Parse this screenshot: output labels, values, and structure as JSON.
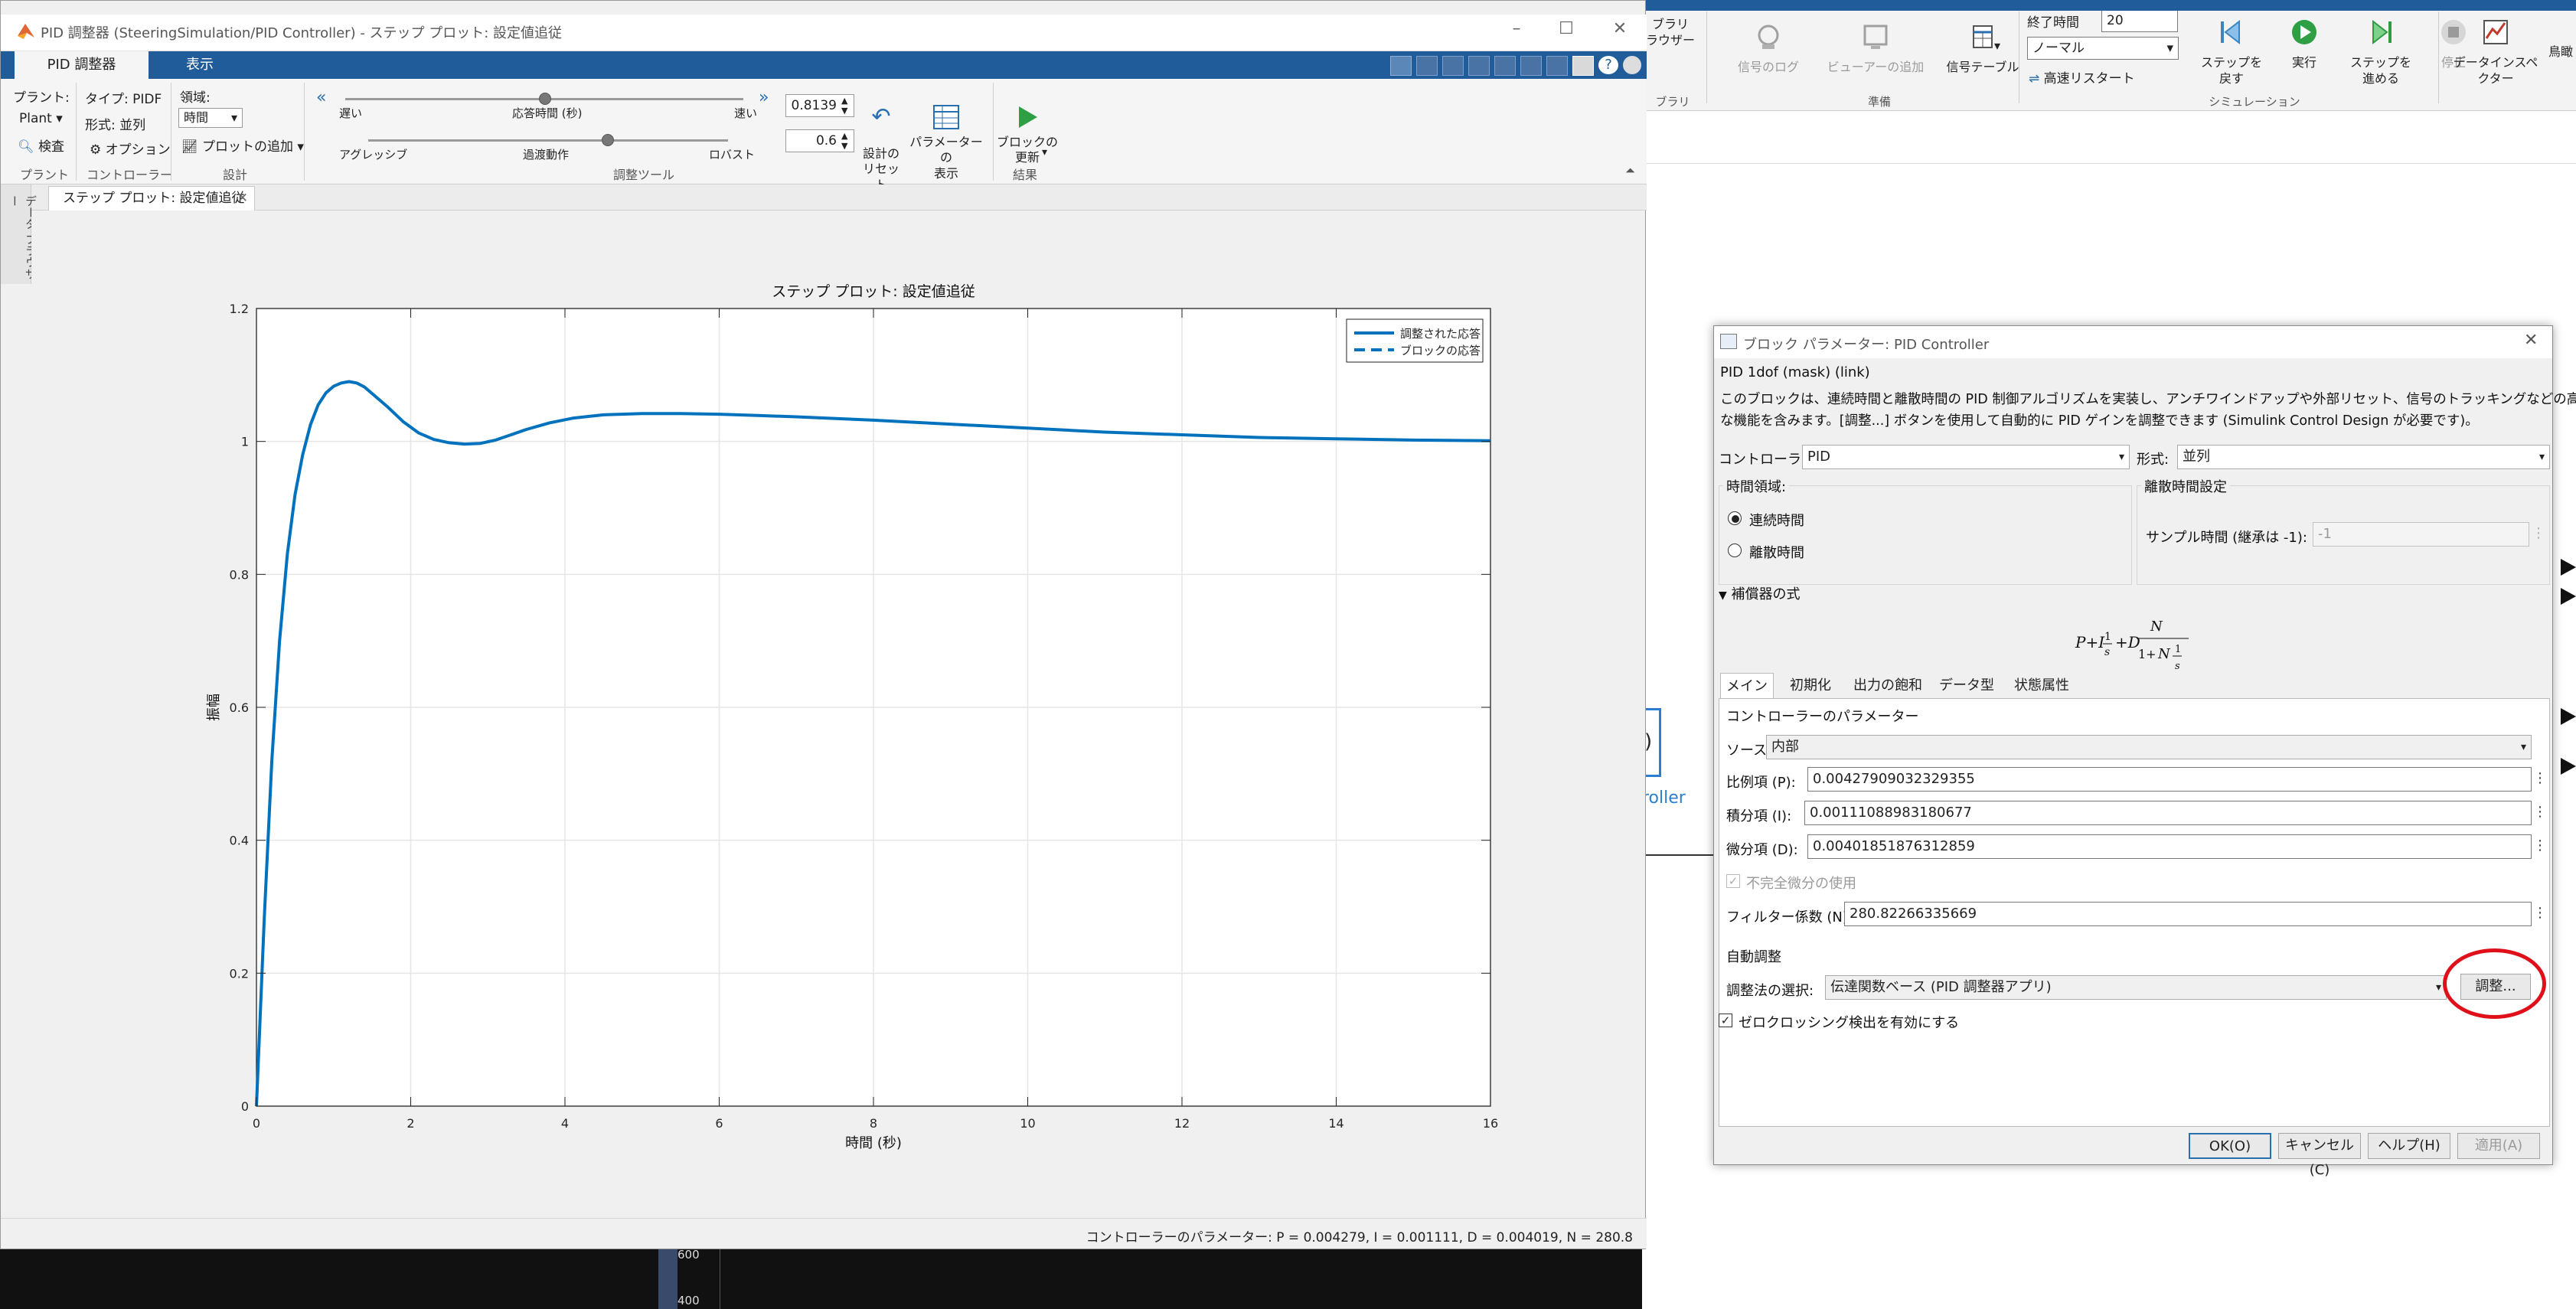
{
  "pid_window": {
    "title": "PID 調整器 (SteeringSimulation/PID Controller) - ステップ プロット: 設定値追従",
    "tabs": [
      "PID 調整器",
      "表示"
    ],
    "plant_label": "プラント:",
    "plant_value": "Plant",
    "type_label": "タイプ: PIDF",
    "form_label": "形式: 並列",
    "domain_label": "領域:",
    "domain_value": "時間",
    "inspect_label": "検査",
    "options_label": "オプション",
    "add_plot_label": "プロットの追加",
    "group_plant": "プラント",
    "group_controller": "コントローラー",
    "group_design": "設計",
    "group_tuning": "調整ツール",
    "group_result": "結果",
    "slider1_left": "遅い",
    "slider1_center": "応答時間 (秒)",
    "slider1_right": "速い",
    "slider2_left": "アグレッシブ",
    "slider2_center": "過渡動作",
    "slider2_right": "ロバスト",
    "response_time_value": "0.8139",
    "transient_value": "0.6",
    "reset_design_label": "設計の\nリセット",
    "show_params_label": "パラメーターの\n表示",
    "update_block_label": "ブロックの\n更新",
    "doc_tab": "ステップ プロット: 設定値追従",
    "side_label": "データ ブラウザー",
    "status_text": "コントローラーのパラメーター: P = 0.004279, I = 0.001111, D = 0.004019, N = 280.8"
  },
  "chart_data": {
    "type": "line",
    "title": "ステップ プロット: 設定値追従",
    "xlabel": "時間 (秒)",
    "ylabel": "振幅",
    "xlim": [
      0,
      16
    ],
    "ylim": [
      0,
      1.2
    ],
    "xticks": [
      0,
      2,
      4,
      6,
      8,
      10,
      12,
      14,
      16
    ],
    "yticks": [
      0,
      0.2,
      0.4,
      0.6,
      0.8,
      1,
      1.2
    ],
    "grid": true,
    "legend_position": "top-right",
    "series": [
      {
        "name": "調整された応答",
        "style": "solid",
        "color": "#0072BD",
        "x": [
          0,
          0.1,
          0.2,
          0.3,
          0.4,
          0.5,
          0.6,
          0.7,
          0.8,
          0.9,
          1.0,
          1.1,
          1.2,
          1.3,
          1.4,
          1.5,
          1.7,
          1.9,
          2.1,
          2.3,
          2.5,
          2.7,
          2.9,
          3.1,
          3.3,
          3.5,
          3.8,
          4.1,
          4.5,
          5.0,
          5.5,
          6.0,
          6.5,
          7.0,
          8.0,
          9.0,
          10.0,
          11.0,
          12.0,
          13.0,
          14.0,
          15.0,
          16.0
        ],
        "y": [
          0,
          0.28,
          0.52,
          0.7,
          0.83,
          0.92,
          0.98,
          1.025,
          1.055,
          1.073,
          1.083,
          1.088,
          1.09,
          1.088,
          1.082,
          1.072,
          1.052,
          1.03,
          1.013,
          1.003,
          0.998,
          0.996,
          0.997,
          1.002,
          1.01,
          1.018,
          1.028,
          1.035,
          1.04,
          1.042,
          1.042,
          1.041,
          1.039,
          1.037,
          1.032,
          1.026,
          1.02,
          1.014,
          1.01,
          1.006,
          1.004,
          1.002,
          1.001
        ]
      },
      {
        "name": "ブロックの応答",
        "style": "dashed",
        "color": "#0072BD"
      }
    ]
  },
  "dialog": {
    "title": "ブロック パラメーター: PID Controller",
    "subtitle": "PID 1dof (mask) (link)",
    "description_1": "このブロックは、連続時間と離散時間の PID 制御アルゴリズムを実装し、アンチワインドアップや外部リセット、信号のトラッキングなどの高度",
    "description_2": "な機能を含みます。[調整...] ボタンを使用して自動的に PID ゲインを調整できます (Simulink Control Design が必要です)。",
    "controller_label": "コントローラー:",
    "controller_value": "PID",
    "form_label": "形式:",
    "form_value": "並列",
    "time_domain_label": "時間領域:",
    "continuous_label": "連続時間",
    "discrete_label": "離散時間",
    "discrete_settings_label": "離散時間設定",
    "sample_time_label": "サンプル時間 (継承は -1):",
    "sample_time_value": "-1",
    "compensator_label": "補償器の式",
    "tabs": [
      "メイン",
      "初期化",
      "出力の飽和",
      "データ型",
      "状態属性"
    ],
    "controller_params_label": "コントローラーのパラメーター",
    "source_label": "ソース:",
    "source_value": "内部",
    "p_label": "比例項 (P):",
    "p_value": "0.00427909032329355",
    "i_label": "積分項 (I):",
    "i_value": "0.00111088983180677",
    "d_label": "微分項 (D):",
    "d_value": "0.00401851876312859",
    "incomplete_derivative_label": "不完全微分の使用",
    "filter_label": "フィルター係数 (N):",
    "filter_value": "280.82266335669",
    "auto_tune_label": "自動調整",
    "tune_method_label": "調整法の選択:",
    "tune_method_value": "伝達関数ベース (PID 調整器アプリ)",
    "tune_button": "調整...",
    "zero_crossing_label": "ゼロクロッシング検出を有効にする",
    "ok_button": "OK(O)",
    "cancel_button": "キャンセル(C)",
    "help_button": "ヘルプ(H)",
    "apply_button": "適用(A)"
  },
  "simulink": {
    "stop_time_label": "終了時間",
    "stop_time_value": "20",
    "mode_value": "ノーマル",
    "fast_restart_label": "高速リスタート",
    "btn_signal_log": "信号のログ",
    "btn_add_viewer": "ビューアーの追加",
    "btn_signal_table": "信号テーブル",
    "btn_step_back": "ステップを\n戻す",
    "btn_run": "実行",
    "btn_step_forward": "ステップを\n進める",
    "btn_stop": "停止",
    "btn_data_inspector": "データインスペ\nクター",
    "btn_cut": "鳥瞰",
    "btn_library": "ブラリ",
    "btn_browser": "ラウザー",
    "group_prepare": "準備",
    "group_simulation": "シミュレーション",
    "group_library": "ブラリ",
    "block_caption": "roller",
    "block_text": ")",
    "scope_ticks": [
      "600",
      "400"
    ]
  }
}
